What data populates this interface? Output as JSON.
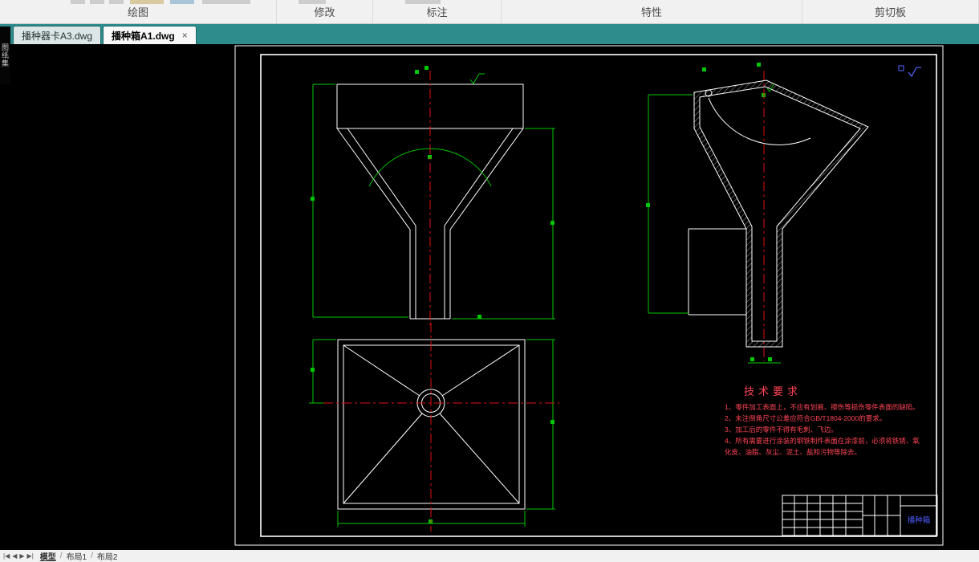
{
  "ribbon": {
    "panels": [
      {
        "label": "绘图"
      },
      {
        "label": "修改"
      },
      {
        "label": "标注"
      },
      {
        "label": "特性"
      },
      {
        "label": "剪切板"
      }
    ]
  },
  "doc_tabs": {
    "tabs": [
      {
        "label": "播种器卡A3.dwg"
      },
      {
        "label": "播种箱A1.dwg"
      }
    ],
    "close_glyph": "×"
  },
  "left_palette": {
    "label": "图纸集"
  },
  "drawing": {
    "tech_title": "技术要求",
    "tech_items": [
      "1、零件加工表面上，不应有划痕、擦伤等损伤零件表面的缺陷。",
      "2、未注倒角尺寸公差应符合GB/T1804-2000的要求。",
      "3、加工后的零件不得有毛刺、飞边。",
      "4、所有需要进行涂装的钢铁制件表面在涂漆前，必须将铁锈、氧",
      "化皮、油脂、灰尘、泥土、盐和污物等除去。"
    ],
    "title_block": {
      "part_name": "播种箱"
    }
  },
  "status": {
    "nav_icons": [
      "|◀",
      "◀",
      "▶",
      "▶|"
    ],
    "layout_tabs": [
      {
        "label": "模型"
      },
      {
        "label": "布局1"
      },
      {
        "label": "布局2"
      }
    ],
    "separator": "/"
  },
  "colors": {
    "geometry_line": "#ffffff",
    "dimension": "#00c800",
    "centerline": "#e01010",
    "tech_text": "#ff4455",
    "title_text": "#4d5dff",
    "tabbar": "#2e8c8c"
  }
}
